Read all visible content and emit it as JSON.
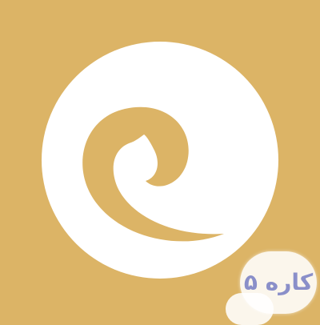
{
  "icon": {
    "name": "swirl-logo",
    "background_color": "#dcb466",
    "foreground_color": "#ffffff"
  },
  "watermark": {
    "text": "کاره ۵",
    "text_color": "#8a8fc9"
  }
}
